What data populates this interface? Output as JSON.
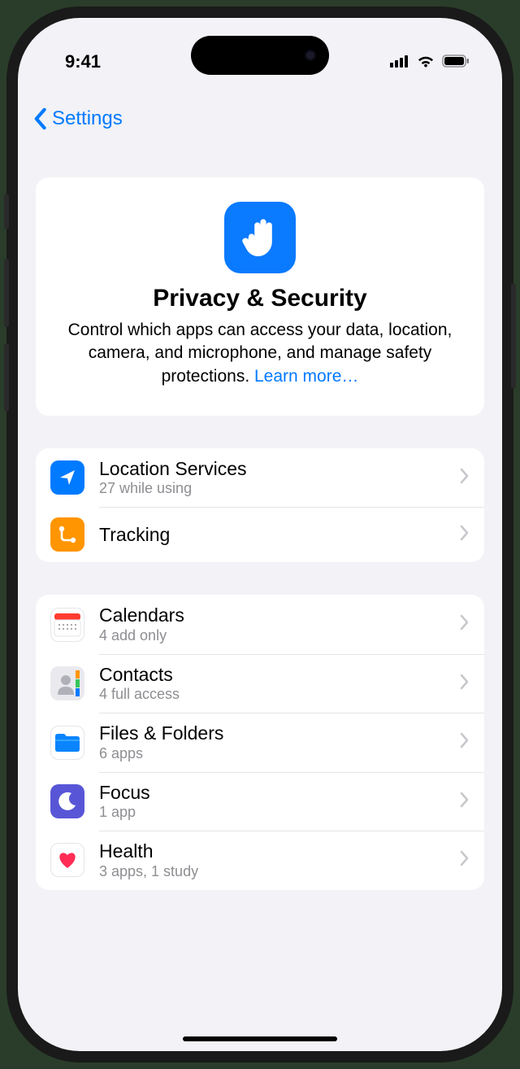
{
  "status": {
    "time": "9:41"
  },
  "nav": {
    "back_label": "Settings"
  },
  "hero": {
    "title": "Privacy & Security",
    "description": "Control which apps can access your data, location, camera, and microphone, and manage safety protections. ",
    "learn_more": "Learn more…"
  },
  "group1": [
    {
      "label": "Location Services",
      "sub": "27 while using",
      "icon": "location-arrow-icon"
    },
    {
      "label": "Tracking",
      "sub": "",
      "icon": "tracking-icon"
    }
  ],
  "group2": [
    {
      "label": "Calendars",
      "sub": "4 add only",
      "icon": "calendar-icon"
    },
    {
      "label": "Contacts",
      "sub": "4 full access",
      "icon": "contacts-icon"
    },
    {
      "label": "Files & Folders",
      "sub": "6 apps",
      "icon": "files-icon"
    },
    {
      "label": "Focus",
      "sub": "1 app",
      "icon": "focus-icon"
    },
    {
      "label": "Health",
      "sub": "3 apps, 1 study",
      "icon": "health-icon"
    }
  ]
}
